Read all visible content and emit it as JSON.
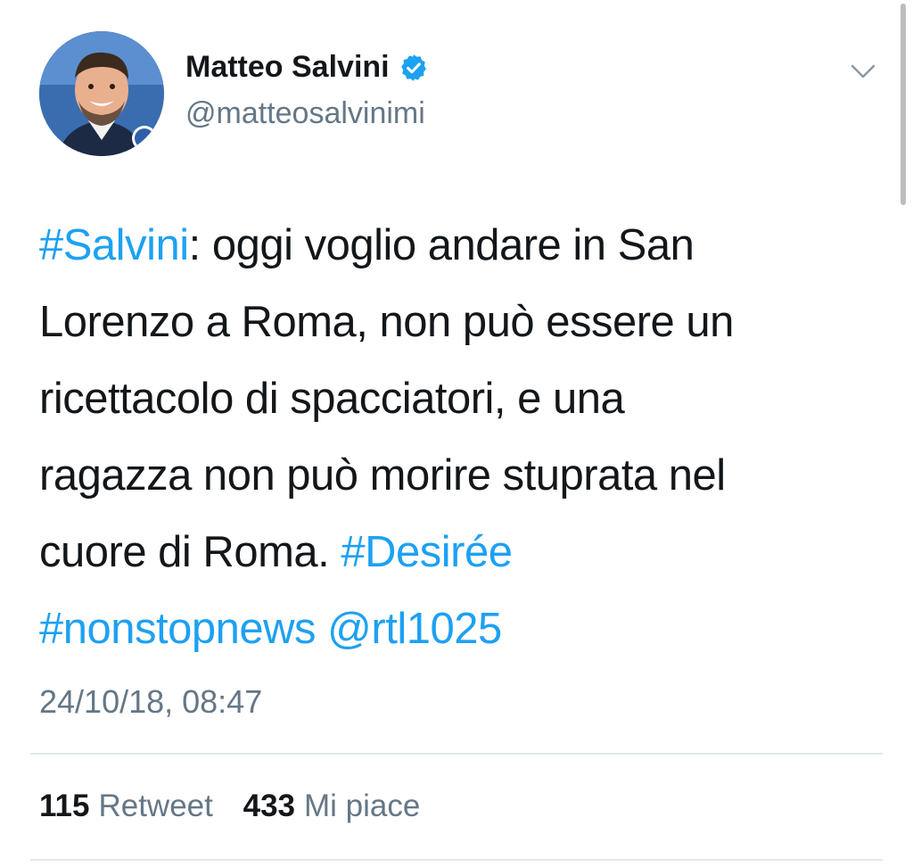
{
  "author": {
    "name": "Matteo Salvini",
    "handle": "@matteosalvinimi",
    "verified": true,
    "avatar_icon": "profile-photo"
  },
  "tweet": {
    "lines": [
      [
        {
          "text": "#Salvini",
          "type": "hashtag"
        },
        {
          "text": ": oggi voglio andare in San",
          "type": "text"
        }
      ],
      [
        {
          "text": "Lorenzo a Roma, non può essere un",
          "type": "text"
        }
      ],
      [
        {
          "text": "ricettacolo di spacciatori, e una",
          "type": "text"
        }
      ],
      [
        {
          "text": "ragazza non può morire stuprata nel",
          "type": "text"
        }
      ],
      [
        {
          "text": "cuore di Roma. ",
          "type": "text"
        },
        {
          "text": "#Desirée",
          "type": "hashtag"
        }
      ],
      [
        {
          "text": "#nonstopnews",
          "type": "hashtag"
        },
        {
          "text": " ",
          "type": "text"
        },
        {
          "text": "@rtl1025",
          "type": "mention"
        }
      ]
    ],
    "timestamp": "24/10/18, 08:47"
  },
  "stats": {
    "retweets_count": "115",
    "retweets_label": "Retweet",
    "likes_count": "433",
    "likes_label": "Mi piace"
  },
  "icons": {
    "menu": "chevron-down-icon",
    "verified": "verified-badge-icon"
  },
  "colors": {
    "link": "#1da1f2",
    "secondary_text": "#657786",
    "primary_text": "#14171a",
    "divider": "#e1e8ed"
  }
}
